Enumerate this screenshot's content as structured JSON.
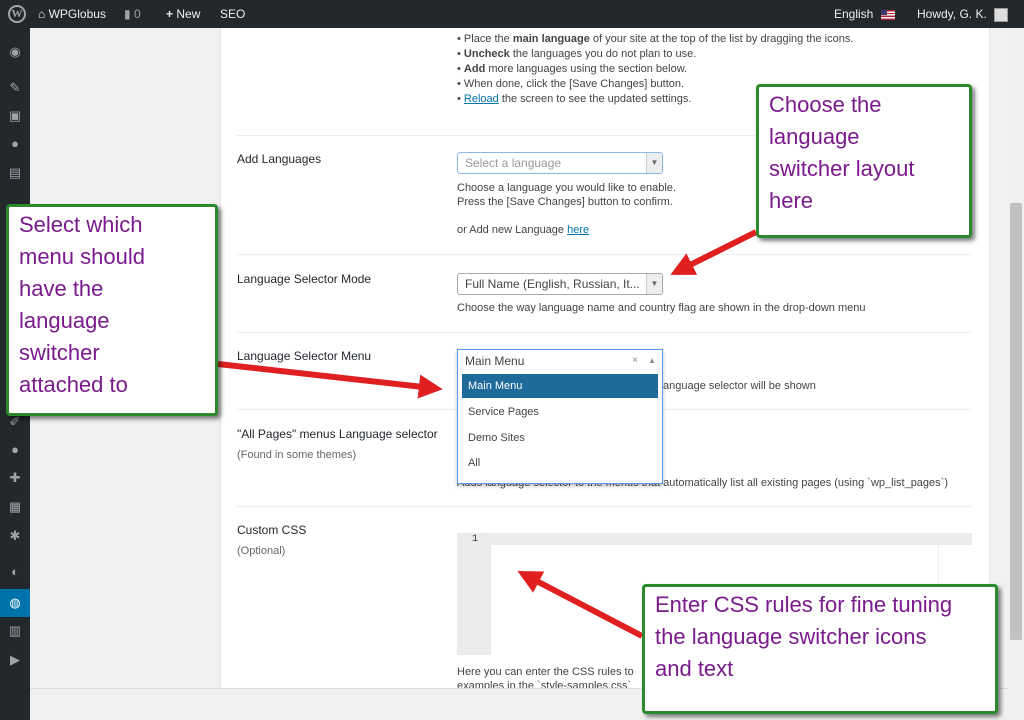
{
  "adminbar": {
    "site_name": "WPGlobus",
    "comments_count": "0",
    "new_label": "New",
    "seo_label": "SEO",
    "language": "English",
    "howdy": "Howdy, G. K."
  },
  "intro": {
    "bullets": [
      {
        "text": "Place the main language of your site at the top of the list by dragging the icons."
      },
      {
        "text": "Uncheck the languages you do not plan to use."
      },
      {
        "text": "Add more languages using the section below."
      },
      {
        "text": "When done, click the [Save Changes] button."
      },
      {
        "text": "Reload the screen to see the updated settings."
      }
    ]
  },
  "add_languages": {
    "label": "Add Languages",
    "placeholder": "Select a language",
    "desc1": "Choose a language you would like to enable.",
    "desc2": "Press the [Save Changes] button to confirm.",
    "desc3_prefix": "or Add new Language ",
    "desc3_link": "here"
  },
  "selector_mode": {
    "label": "Language Selector Mode",
    "value": "Full Name (English, Russian, It...",
    "desc": "Choose the way language name and country flag are shown in the drop-down menu"
  },
  "selector_menu": {
    "label": "Language Selector Menu",
    "value": "Main Menu",
    "clear": "×",
    "desc_tail": "anguage selector will be shown",
    "options": [
      {
        "label": "Main Menu",
        "selected": true
      },
      {
        "label": "Service Pages",
        "selected": false
      },
      {
        "label": "Demo Sites",
        "selected": false
      },
      {
        "label": "All",
        "selected": false
      }
    ]
  },
  "all_pages": {
    "label": "\"All Pages\" menus Language selector",
    "sublabel": "(Found in some themes)",
    "desc": "Adds language selector to the menus that automatically list all existing pages (using `wp_list_pages`)"
  },
  "custom_css": {
    "label": "Custom CSS",
    "sublabel": "(Optional)",
    "line_number": "1",
    "desc1": "Here you can enter the CSS rules to",
    "desc2": "examples in the `style-samples.css`"
  },
  "callouts": {
    "layout": [
      "Choose the",
      "language",
      "switcher layout",
      "here"
    ],
    "menu": [
      "Select which",
      "menu should",
      "have the",
      "language",
      "switcher",
      "attached to"
    ],
    "css": [
      "Enter CSS rules for fine tuning",
      "the language switcher icons",
      "and text"
    ]
  },
  "colors": {
    "admin_bar": "#23282d",
    "accent": "#0073aa",
    "callout_border": "#2c8a2c",
    "callout_text": "#7a1a8c",
    "arrow": "#e02020"
  }
}
